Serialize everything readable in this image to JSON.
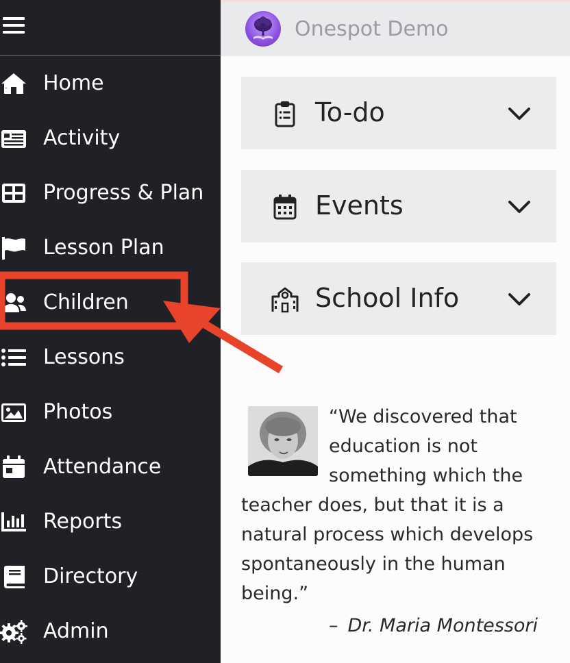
{
  "app": {
    "title": "Onespot Demo"
  },
  "sidebar": {
    "items": [
      {
        "label": "Home",
        "icon": "home-icon"
      },
      {
        "label": "Activity",
        "icon": "newspaper-icon"
      },
      {
        "label": "Progress & Plan",
        "icon": "grid-icon"
      },
      {
        "label": "Lesson Plan",
        "icon": "flag-icon"
      },
      {
        "label": "Children",
        "icon": "users-icon"
      },
      {
        "label": "Lessons",
        "icon": "list-icon"
      },
      {
        "label": "Photos",
        "icon": "image-icon"
      },
      {
        "label": "Attendance",
        "icon": "calendar-day-icon"
      },
      {
        "label": "Reports",
        "icon": "bar-chart-icon"
      },
      {
        "label": "Directory",
        "icon": "book-icon"
      },
      {
        "label": "Admin",
        "icon": "gears-icon"
      }
    ]
  },
  "main": {
    "sections": [
      {
        "label": "To-do",
        "icon": "clipboard-list-icon"
      },
      {
        "label": "Events",
        "icon": "calendar-icon"
      },
      {
        "label": "School Info",
        "icon": "school-icon"
      }
    ],
    "quote": {
      "text": "“We discovered that education is not something which the teacher does, but that it is a natural process which develops spontaneously in the human being.”",
      "dash": "–",
      "author": "Dr. Maria Montessori"
    }
  },
  "colors": {
    "sidebar_bg": "#1f2126",
    "topbar_bg": "#e9eaec",
    "accordion_bg": "#ececec",
    "annotation_red": "#e8432b"
  }
}
